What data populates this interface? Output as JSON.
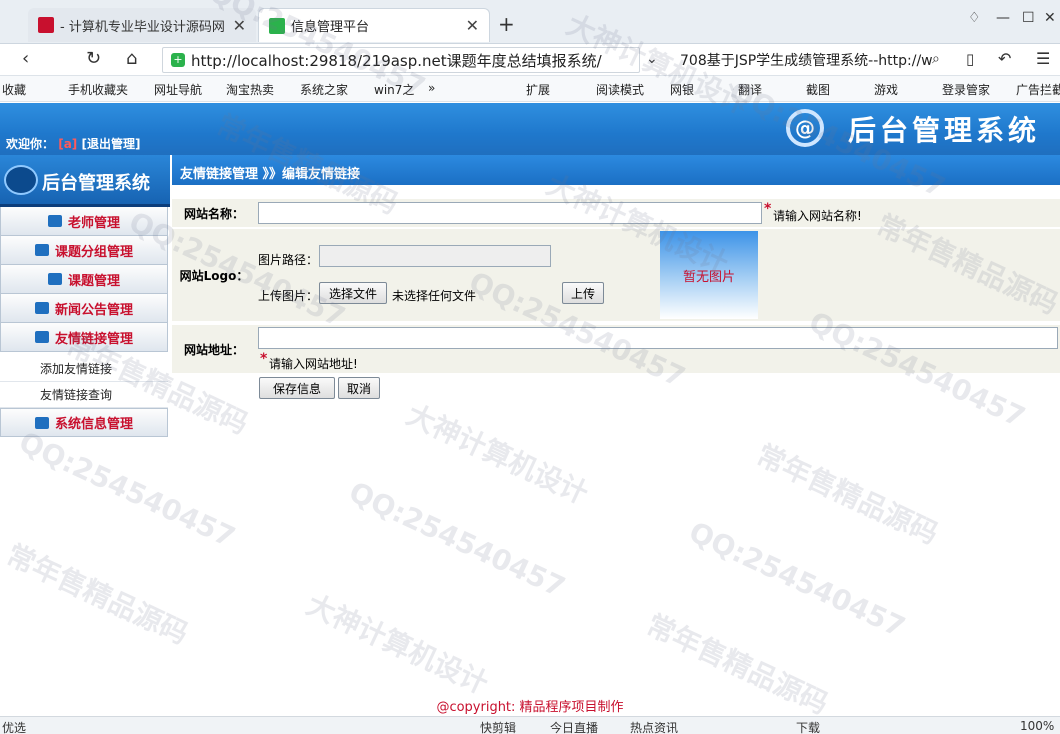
{
  "browser": {
    "tabs": [
      {
        "title": "- 计算机专业毕业设计源码网"
      },
      {
        "title": "信息管理平台"
      }
    ],
    "new_tab": "+",
    "address": "http://localhost:29818/219asp.net课题年度总结填报系统/",
    "search": "708基于JSP学生成绩管理系统--http://w",
    "bookmarks": [
      "收藏",
      "手机收藏夹",
      "网址导航",
      "淘宝热卖",
      "系统之家",
      "win7之",
      "扩展",
      "阅读模式",
      "网银",
      "翻译",
      "截图",
      "游戏",
      "登录管家",
      "广告拦截"
    ],
    "status": {
      "left": "优选",
      "items": [
        "快剪辑",
        "今日直播",
        "热点资讯",
        "下载",
        "100%"
      ]
    }
  },
  "header": {
    "welcome_label": "欢迎你：",
    "user": "[a]",
    "logout": "[退出管理]",
    "system_title": "后台管理系统",
    "logo_glyph": "@"
  },
  "sidebar": {
    "title": "后台管理系统",
    "menus": [
      {
        "label": "老师管理"
      },
      {
        "label": "课题分组管理"
      },
      {
        "label": "课题管理"
      },
      {
        "label": "新闻公告管理"
      },
      {
        "label": "友情链接管理"
      }
    ],
    "submenu": [
      "添加友情链接",
      "友情链接查询"
    ],
    "bottom_menu": "系统信息管理"
  },
  "breadcrumb": "友情链接管理 》》编辑友情链接",
  "form": {
    "site_name_label": "网站名称：",
    "site_name_value": "",
    "site_name_hint": "请输入网站名称!",
    "logo_label": "网站Logo：",
    "image_path_label": "图片路径：",
    "image_path_value": "",
    "upload_label": "上传图片：",
    "choose_file": "选择文件",
    "no_file": "未选择任何文件",
    "upload_button": "上传",
    "no_image": "暂无图片",
    "site_url_label": "网站地址：",
    "site_url_value": "",
    "site_url_hint": "请输入网站地址!",
    "required_mark": "*",
    "save_button": "保存信息",
    "cancel_button": "取消"
  },
  "footer": "@copyright: 精品程序项目制作",
  "watermarks": [
    "大神计算机设计",
    "常年售精品源码",
    "QQ:254540457"
  ]
}
